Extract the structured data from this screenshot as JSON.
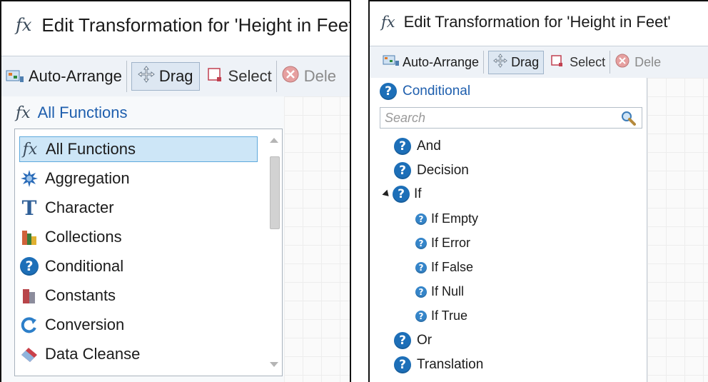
{
  "left_panel": {
    "title": "Edit Transformation for 'Height in Feet'",
    "toolbar": {
      "auto_arrange": "Auto-Arrange",
      "drag": "Drag",
      "select": "Select",
      "delete": "Dele"
    },
    "category_header": "All Functions",
    "list_items": [
      {
        "label": "All Functions",
        "icon": "fx-icon",
        "selected": true
      },
      {
        "label": "Aggregation",
        "icon": "aggregation-star-icon"
      },
      {
        "label": "Character",
        "icon": "character-t-icon"
      },
      {
        "label": "Collections",
        "icon": "collections-books-icon"
      },
      {
        "label": "Conditional",
        "icon": "question-icon"
      },
      {
        "label": "Constants",
        "icon": "constants-books-icon"
      },
      {
        "label": "Conversion",
        "icon": "conversion-arrow-icon"
      },
      {
        "label": "Data Cleanse",
        "icon": "eraser-icon"
      }
    ]
  },
  "right_panel": {
    "title": "Edit Transformation for 'Height in Feet'",
    "toolbar": {
      "auto_arrange": "Auto-Arrange",
      "drag": "Drag",
      "select": "Select",
      "delete": "Dele"
    },
    "category_header": "Conditional",
    "search": {
      "placeholder": "Search"
    },
    "tree": [
      {
        "label": "And"
      },
      {
        "label": "Decision"
      },
      {
        "label": "If",
        "expanded": true,
        "children": [
          {
            "label": "If Empty"
          },
          {
            "label": "If Error"
          },
          {
            "label": "If False"
          },
          {
            "label": "If Null"
          },
          {
            "label": "If True"
          }
        ]
      },
      {
        "label": "Or"
      },
      {
        "label": "Translation"
      }
    ]
  },
  "colors": {
    "accent_blue": "#1d6fb8",
    "selection": "#cde6f7",
    "toolbar_bg": "#eef2f7"
  }
}
